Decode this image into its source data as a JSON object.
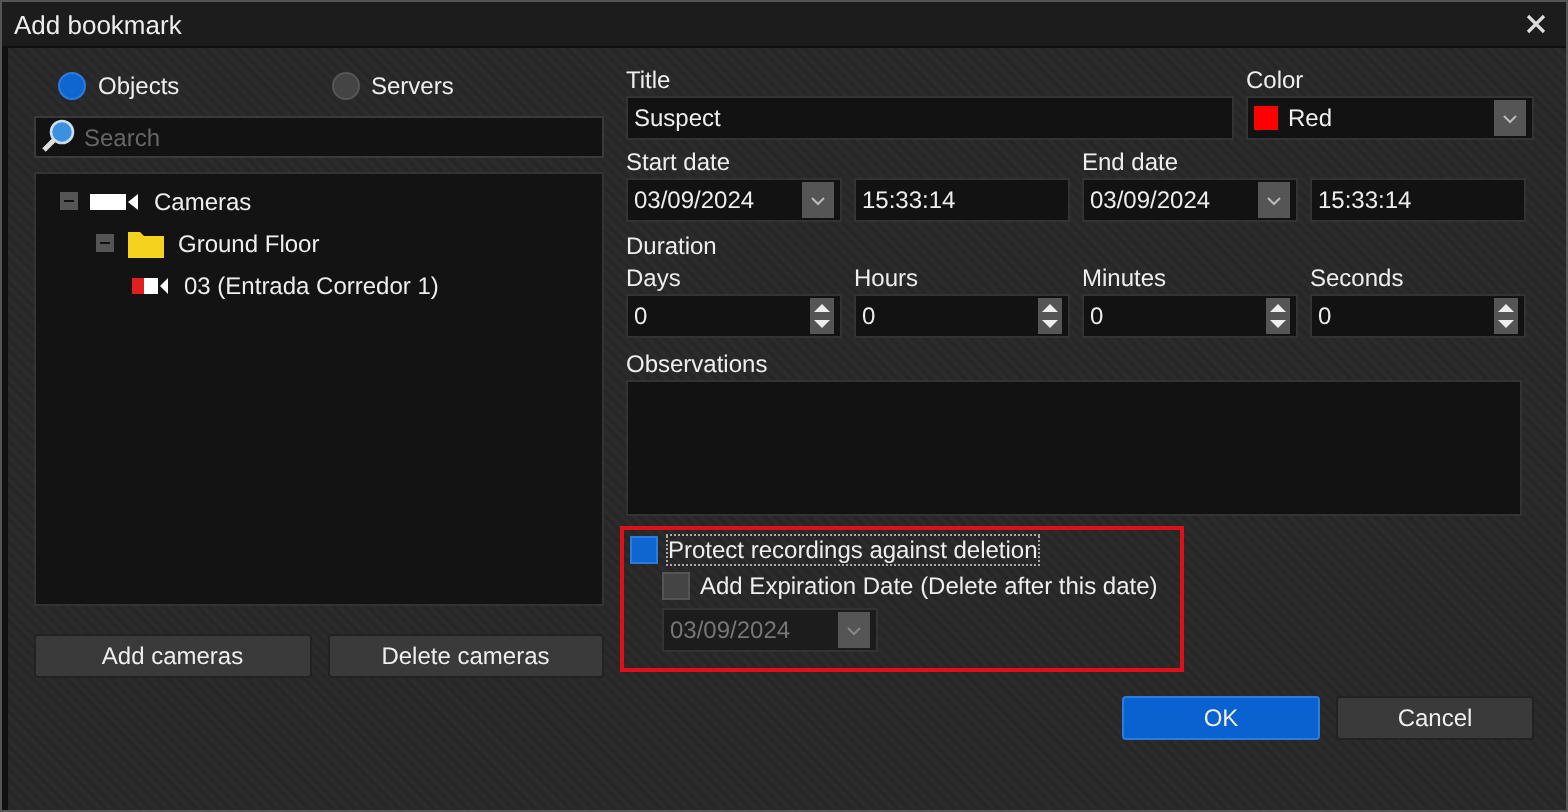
{
  "window": {
    "title": "Add bookmark"
  },
  "source_tabs": [
    {
      "label": "Objects",
      "selected": true
    },
    {
      "label": "Servers",
      "selected": false
    }
  ],
  "search": {
    "placeholder": "Search"
  },
  "tree": [
    {
      "label": "Cameras",
      "kind": "cameras",
      "expanded": true,
      "children": [
        {
          "label": "Ground Floor",
          "kind": "folder",
          "expanded": true,
          "children": [
            {
              "label": "03 (Entrada Corredor 1)",
              "kind": "camera"
            }
          ]
        }
      ]
    }
  ],
  "left_buttons": [
    "Add cameras",
    "Delete cameras"
  ],
  "title_field": {
    "label": "Title",
    "value": "Suspect"
  },
  "color_field": {
    "label": "Color",
    "value": "Red",
    "color": "#ff0000"
  },
  "start": {
    "label": "Start date",
    "date": "03/09/2024",
    "time": "15:33:14"
  },
  "end": {
    "label": "End date",
    "date": "03/09/2024",
    "time": "15:33:14"
  },
  "duration": {
    "label": "Duration",
    "fields": [
      {
        "label": "Days",
        "value": "0"
      },
      {
        "label": "Hours",
        "value": "0"
      },
      {
        "label": "Minutes",
        "value": "0"
      },
      {
        "label": "Seconds",
        "value": "0"
      }
    ]
  },
  "observations": {
    "label": "Observations"
  },
  "protection": {
    "highlighted": true,
    "protect": {
      "label": "Protect recordings against deletion",
      "checked": true
    },
    "expiration": {
      "label": "Add Expiration Date (Delete after this date)",
      "checked": false
    },
    "date": {
      "value": "03/09/2024",
      "disabled": true
    }
  },
  "buttons": [
    {
      "label": "OK",
      "primary": true
    },
    {
      "label": "Cancel",
      "primary": false
    }
  ]
}
